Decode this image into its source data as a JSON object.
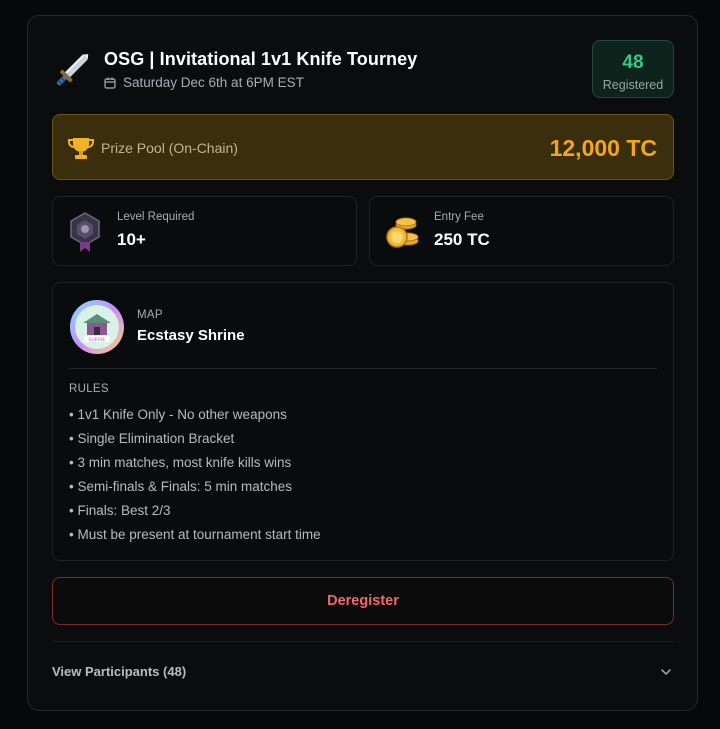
{
  "tournament": {
    "title": "OSG | Invitational 1v1 Knife Tourney",
    "date": "Saturday Dec 6th at 6PM EST",
    "registered_count": "48",
    "registered_label": "Registered"
  },
  "prize_pool": {
    "label": "Prize Pool (On-Chain)",
    "amount": "12,000 TC"
  },
  "level": {
    "label": "Level Required",
    "value": "10+"
  },
  "entry_fee": {
    "label": "Entry Fee",
    "value": "250 TC"
  },
  "map": {
    "label": "MAP",
    "name": "Ecstasy Shrine",
    "thumb_text": "SHRINE"
  },
  "rules": {
    "label": "RULES",
    "items": [
      "1v1 Knife Only - No other weapons",
      "Single Elimination Bracket",
      "3 min matches, most knife kills wins",
      "Semi-finals & Finals: 5 min matches",
      "Finals: Best 2/3",
      "Must be present at tournament start time"
    ]
  },
  "actions": {
    "deregister_label": "Deregister",
    "participants_label": "View Participants (48)"
  },
  "colors": {
    "accent_green": "#35c98a",
    "prize_gold": "#f3a51d",
    "danger_red": "#ef6a6a"
  },
  "icons": [
    "knife-icon",
    "calendar-icon",
    "trophy-icon",
    "level-badge-icon",
    "coins-icon",
    "map-thumbnail",
    "chevron-down-icon"
  ]
}
